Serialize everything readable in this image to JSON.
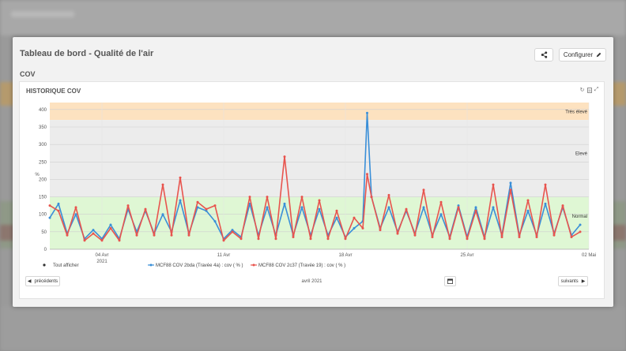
{
  "page": {
    "title": "Tableau de bord - Qualité de l'air",
    "section": "COV",
    "configure_label": "Configurer"
  },
  "card": {
    "title": "HISTORIQUE COV"
  },
  "navigation": {
    "prev_label": "précédents",
    "next_label": "suivants",
    "period_label": "avril 2021"
  },
  "colors": {
    "series_blue": "#3a8fd8",
    "series_red": "#e8544e",
    "zone_very_high": "#fde2c0",
    "zone_high": "#ececec",
    "zone_normal": "#dff7d4"
  },
  "chart_data": {
    "type": "line",
    "ylabel": "%",
    "ylim": [
      0,
      420
    ],
    "yticks": [
      0,
      50,
      100,
      150,
      200,
      250,
      300,
      350,
      400
    ],
    "xlabel": "",
    "x_range": [
      "2021-04-01",
      "2021-05-02"
    ],
    "x_ticks": [
      {
        "date": "2021-04-04",
        "label": "04 Avr",
        "sub": "2021"
      },
      {
        "date": "2021-04-11",
        "label": "11 Avr",
        "sub": ""
      },
      {
        "date": "2021-04-18",
        "label": "18 Avr",
        "sub": ""
      },
      {
        "date": "2021-04-25",
        "label": "25 Avr",
        "sub": ""
      },
      {
        "date": "2021-05-02",
        "label": "02 Mai",
        "sub": ""
      }
    ],
    "zones": [
      {
        "label": "Très élevé",
        "from": 370,
        "to": 420
      },
      {
        "label": "Elevé",
        "from": 150,
        "to": 370
      },
      {
        "label": "Normal",
        "from": 0,
        "to": 150
      }
    ],
    "legend": {
      "all_label": "Tout afficher",
      "placement": "bottom"
    },
    "series": [
      {
        "name": "MCF88 COV 2bda (Travée 4a) : cov ( % )",
        "color": "#3a8fd8",
        "points": [
          [
            "2021-04-01",
            90
          ],
          [
            "2021-04-01T12:00",
            130
          ],
          [
            "2021-04-02",
            45
          ],
          [
            "2021-04-02T12:00",
            100
          ],
          [
            "2021-04-03",
            30
          ],
          [
            "2021-04-03T12:00",
            55
          ],
          [
            "2021-04-04",
            30
          ],
          [
            "2021-04-04T12:00",
            70
          ],
          [
            "2021-04-05",
            30
          ],
          [
            "2021-04-05T12:00",
            115
          ],
          [
            "2021-04-06",
            50
          ],
          [
            "2021-04-06T12:00",
            110
          ],
          [
            "2021-04-07",
            45
          ],
          [
            "2021-04-07T12:00",
            100
          ],
          [
            "2021-04-08",
            50
          ],
          [
            "2021-04-08T12:00",
            140
          ],
          [
            "2021-04-09",
            45
          ],
          [
            "2021-04-09T12:00",
            120
          ],
          [
            "2021-04-10",
            110
          ],
          [
            "2021-04-10T12:00",
            80
          ],
          [
            "2021-04-11",
            30
          ],
          [
            "2021-04-11T12:00",
            55
          ],
          [
            "2021-04-12",
            35
          ],
          [
            "2021-04-12T12:00",
            130
          ],
          [
            "2021-04-13",
            40
          ],
          [
            "2021-04-13T12:00",
            120
          ],
          [
            "2021-04-14",
            40
          ],
          [
            "2021-04-14T12:00",
            130
          ],
          [
            "2021-04-15",
            40
          ],
          [
            "2021-04-15T12:00",
            120
          ],
          [
            "2021-04-16",
            40
          ],
          [
            "2021-04-16T12:00",
            115
          ],
          [
            "2021-04-17",
            40
          ],
          [
            "2021-04-17T12:00",
            90
          ],
          [
            "2021-04-18",
            35
          ],
          [
            "2021-04-18T12:00",
            60
          ],
          [
            "2021-04-19",
            80
          ],
          [
            "2021-04-19T06:00",
            390
          ],
          [
            "2021-04-19T12:00",
            150
          ],
          [
            "2021-04-20",
            60
          ],
          [
            "2021-04-20T12:00",
            120
          ],
          [
            "2021-04-21",
            50
          ],
          [
            "2021-04-21T12:00",
            110
          ],
          [
            "2021-04-22",
            45
          ],
          [
            "2021-04-22T12:00",
            120
          ],
          [
            "2021-04-23",
            40
          ],
          [
            "2021-04-23T12:00",
            100
          ],
          [
            "2021-04-24",
            35
          ],
          [
            "2021-04-24T12:00",
            125
          ],
          [
            "2021-04-25",
            35
          ],
          [
            "2021-04-25T12:00",
            120
          ],
          [
            "2021-04-26",
            35
          ],
          [
            "2021-04-26T12:00",
            120
          ],
          [
            "2021-04-27",
            40
          ],
          [
            "2021-04-27T12:00",
            190
          ],
          [
            "2021-04-28",
            40
          ],
          [
            "2021-04-28T12:00",
            110
          ],
          [
            "2021-04-29",
            40
          ],
          [
            "2021-04-29T12:00",
            130
          ],
          [
            "2021-04-30",
            45
          ],
          [
            "2021-04-30T12:00",
            120
          ],
          [
            "2021-05-01",
            40
          ],
          [
            "2021-05-01T12:00",
            70
          ]
        ]
      },
      {
        "name": "MCF88 COV 2c37 (Travée 19) : cov ( % )",
        "color": "#e8544e",
        "points": [
          [
            "2021-04-01",
            125
          ],
          [
            "2021-04-01T12:00",
            110
          ],
          [
            "2021-04-02",
            40
          ],
          [
            "2021-04-02T12:00",
            120
          ],
          [
            "2021-04-03",
            25
          ],
          [
            "2021-04-03T12:00",
            45
          ],
          [
            "2021-04-04",
            25
          ],
          [
            "2021-04-04T12:00",
            60
          ],
          [
            "2021-04-05",
            25
          ],
          [
            "2021-04-05T12:00",
            125
          ],
          [
            "2021-04-06",
            40
          ],
          [
            "2021-04-06T12:00",
            115
          ],
          [
            "2021-04-07",
            40
          ],
          [
            "2021-04-07T12:00",
            185
          ],
          [
            "2021-04-08",
            40
          ],
          [
            "2021-04-08T12:00",
            205
          ],
          [
            "2021-04-09",
            40
          ],
          [
            "2021-04-09T12:00",
            135
          ],
          [
            "2021-04-10",
            115
          ],
          [
            "2021-04-10T12:00",
            125
          ],
          [
            "2021-04-11",
            25
          ],
          [
            "2021-04-11T12:00",
            50
          ],
          [
            "2021-04-12",
            30
          ],
          [
            "2021-04-12T12:00",
            150
          ],
          [
            "2021-04-13",
            30
          ],
          [
            "2021-04-13T12:00",
            150
          ],
          [
            "2021-04-14",
            30
          ],
          [
            "2021-04-14T12:00",
            265
          ],
          [
            "2021-04-15",
            35
          ],
          [
            "2021-04-15T12:00",
            150
          ],
          [
            "2021-04-16",
            30
          ],
          [
            "2021-04-16T12:00",
            140
          ],
          [
            "2021-04-17",
            30
          ],
          [
            "2021-04-17T12:00",
            110
          ],
          [
            "2021-04-18",
            30
          ],
          [
            "2021-04-18T12:00",
            90
          ],
          [
            "2021-04-19",
            60
          ],
          [
            "2021-04-19T06:00",
            215
          ],
          [
            "2021-04-19T12:00",
            150
          ],
          [
            "2021-04-20",
            55
          ],
          [
            "2021-04-20T12:00",
            155
          ],
          [
            "2021-04-21",
            45
          ],
          [
            "2021-04-21T12:00",
            115
          ],
          [
            "2021-04-22",
            40
          ],
          [
            "2021-04-22T12:00",
            170
          ],
          [
            "2021-04-23",
            35
          ],
          [
            "2021-04-23T12:00",
            135
          ],
          [
            "2021-04-24",
            30
          ],
          [
            "2021-04-24T12:00",
            120
          ],
          [
            "2021-04-25",
            30
          ],
          [
            "2021-04-25T12:00",
            110
          ],
          [
            "2021-04-26",
            30
          ],
          [
            "2021-04-26T12:00",
            185
          ],
          [
            "2021-04-27",
            35
          ],
          [
            "2021-04-27T12:00",
            170
          ],
          [
            "2021-04-28",
            35
          ],
          [
            "2021-04-28T12:00",
            140
          ],
          [
            "2021-04-29",
            35
          ],
          [
            "2021-04-29T12:00",
            185
          ],
          [
            "2021-04-30",
            40
          ],
          [
            "2021-04-30T12:00",
            125
          ],
          [
            "2021-05-01",
            35
          ],
          [
            "2021-05-01T12:00",
            50
          ]
        ]
      }
    ]
  }
}
